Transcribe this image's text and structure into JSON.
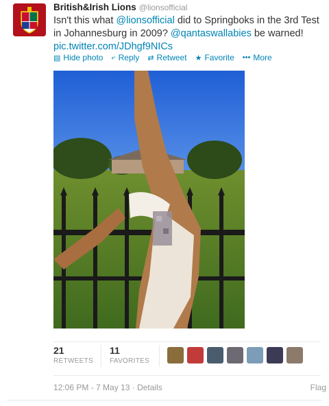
{
  "user": {
    "name": "British&Irish Lions",
    "handle": "@lionsofficial"
  },
  "tweet": {
    "text_1": "Isn't this what ",
    "mention_1": "@lionsofficial",
    "text_2": " did to Springboks in the 3rd Test in Johannesburg in 2009? ",
    "mention_2": "@qantaswallabies",
    "text_3": " be warned!",
    "pic_link": "pic.twitter.com/JDhgf9NICs"
  },
  "actions": {
    "hide_photo": "Hide photo",
    "reply": "Reply",
    "retweet": "Retweet",
    "favorite": "Favorite",
    "more": "More"
  },
  "stats": {
    "retweets_count": "21",
    "retweets_label": "RETWEETS",
    "favorites_count": "11",
    "favorites_label": "FAVORITES"
  },
  "footer": {
    "timestamp": "12:06 PM - 7 May 13",
    "separator": " · ",
    "details": "Details",
    "flag": "Flag"
  },
  "colors": {
    "link": "#0084b4",
    "avatar_bg": "#b3111b"
  }
}
